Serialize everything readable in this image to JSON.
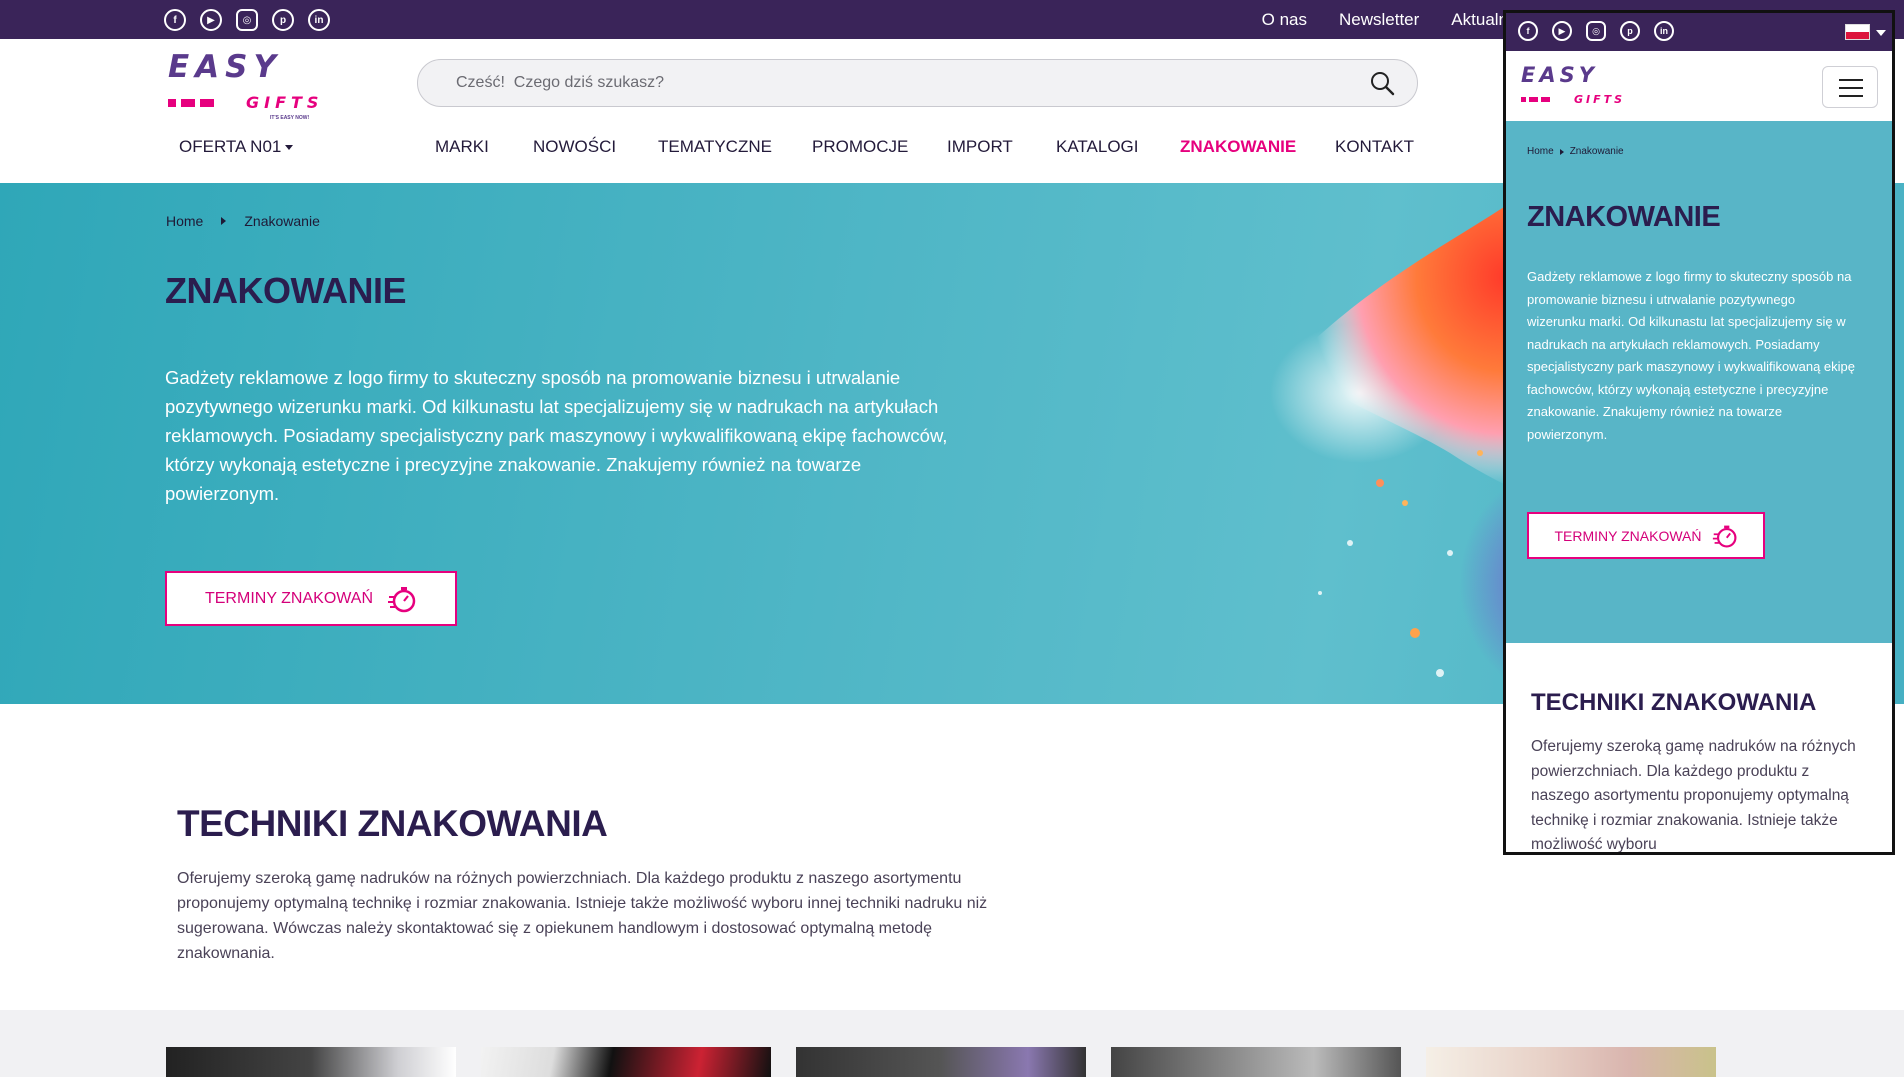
{
  "topbar": {
    "social_icons": [
      "facebook-icon",
      "youtube-icon",
      "instagram-icon",
      "pinterest-icon",
      "linkedin-icon"
    ],
    "links": [
      "O nas",
      "Newsletter",
      "Aktualn"
    ]
  },
  "logo": {
    "easy": "EASY",
    "gifts": "GIFTS",
    "tagline": "IT'S EASY NOW!"
  },
  "search": {
    "placeholder": "Cześć!  Czego dziś szukasz?"
  },
  "nav": {
    "offer": "OFERTA N01",
    "items": [
      "MARKI",
      "NOWOŚCI",
      "TEMATYCZNE",
      "PROMOCJE",
      "IMPORT",
      "KATALOGI",
      "ZNAKOWANIE",
      "KONTAKT"
    ],
    "active": "ZNAKOWANIE"
  },
  "breadcrumb": {
    "home": "Home",
    "current": "Znakowanie"
  },
  "hero": {
    "title": "ZNAKOWANIE",
    "text": "Gadżety reklamowe z logo firmy to skuteczny sposób na promowanie biznesu i utrwalanie pozytywnego wizerunku marki. Od kilkunastu lat specjalizujemy się w nadrukach na artykułach reklamowych. Posiadamy specjalistyczny park maszynowy i wykwalifikowaną ekipę fachowców, którzy wykonają estetyczne i precyzyjne znakowanie. Znakujemy również na towarze powierzonym.",
    "button": "TERMINY ZNAKOWAŃ"
  },
  "techniques": {
    "title": "TECHNIKI ZNAKOWANIA",
    "text": "Oferujemy szeroką gamę nadruków na różnych powierzchniach. Dla każdego produktu z naszego asortymentu proponujemy optymalną technikę i rozmiar znakowania. Istnieje także możliwość wyboru innej techniki nadruku niż sugerowana. Wówczas należy skontaktować się z opiekunem handlowym i dostosować optymalną metodę znakownania."
  },
  "mobile": {
    "techniques_text": "Oferujemy szeroką gamę nadruków na różnych powierzchniach. Dla każdego produktu z naszego asortymentu proponujemy optymalną technikę i rozmiar znakowania. Istnieje także możliwość wyboru"
  },
  "colors": {
    "brand_purple": "#3a2459",
    "accent_pink": "#e6007e",
    "hero_teal": "#4fb6c6"
  }
}
